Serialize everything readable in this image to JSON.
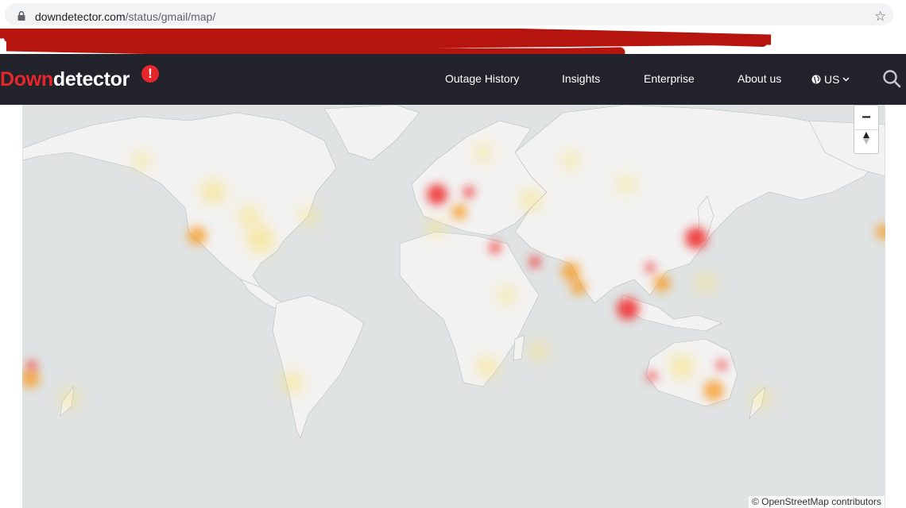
{
  "browser": {
    "url_domain": "downdetector.com",
    "url_path": "/status/gmail/map/"
  },
  "header": {
    "logo_down": "Down",
    "logo_detector": "detector",
    "logo_badge": "!",
    "nav": [
      {
        "label": "Outage History"
      },
      {
        "label": "Insights"
      },
      {
        "label": "Enterprise"
      },
      {
        "label": "About us"
      }
    ],
    "region": "US"
  },
  "map": {
    "attribution": "© OpenStreetMap contributors",
    "zoom_out_label": "−",
    "reset_label": "⥉",
    "hotspot_colors": {
      "high": "#f03030",
      "mid": "#f7a030",
      "low": "#fbe070"
    }
  }
}
